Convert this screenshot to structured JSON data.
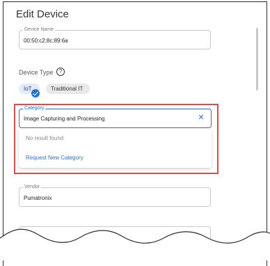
{
  "title": "Edit Device",
  "device_name": {
    "label": "Device Name",
    "value": "00:50:c2:8c:89:6a"
  },
  "device_type": {
    "label": "Device Type",
    "help_icon": "question-circle-icon",
    "options": [
      {
        "label": "IoT",
        "selected": true
      },
      {
        "label": "Traditional IT",
        "selected": false
      }
    ]
  },
  "category": {
    "label": "Category",
    "value": "Image Capturing and Processing",
    "clear_icon": "close-icon",
    "dropdown": {
      "empty_text": "No result found",
      "action_label": "Request New Category"
    }
  },
  "vendor": {
    "label": "Vendor",
    "value": "Pumatronix"
  },
  "colors": {
    "accent": "#2f6fd0",
    "highlight": "#e04a4a",
    "check": "#1e76d6"
  }
}
